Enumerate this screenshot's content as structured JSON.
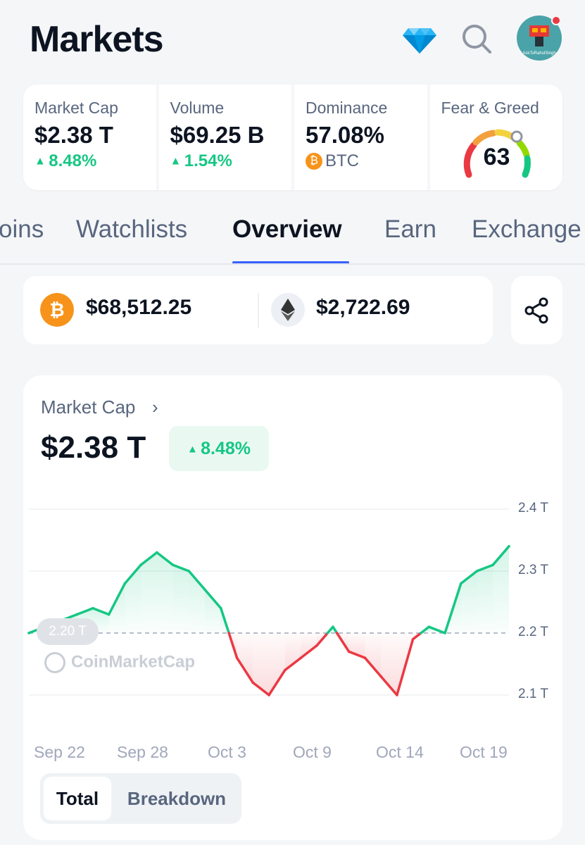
{
  "header": {
    "title": "Markets",
    "icons": [
      "diamond-icon",
      "search-icon",
      "avatar"
    ],
    "avatar_text": "AskToRahulSingh"
  },
  "stats": {
    "market_cap": {
      "label": "Market Cap",
      "value": "$2.38 T",
      "change": "8.48%"
    },
    "volume": {
      "label": "Volume",
      "value": "$69.25 B",
      "change": "1.54%"
    },
    "dominance": {
      "label": "Dominance",
      "value": "57.08%",
      "asset": "BTC"
    },
    "fear_greed": {
      "label": "Fear & Greed",
      "value": "63"
    }
  },
  "tabs": [
    {
      "label": "oins"
    },
    {
      "label": "Watchlists"
    },
    {
      "label": "Overview"
    },
    {
      "label": "Earn"
    },
    {
      "label": "Exchange"
    }
  ],
  "prices": {
    "btc": {
      "value": "$68,512.25"
    },
    "eth": {
      "value": "$2,722.69"
    }
  },
  "chart_card": {
    "title": "Market Cap",
    "value": "$2.38 T",
    "change": "8.48%",
    "reference_label": "2.20 T",
    "watermark": "CoinMarketCap",
    "toggle": {
      "total": "Total",
      "breakdown": "Breakdown"
    }
  },
  "colors": {
    "up": "#16c784",
    "down": "#ea3943",
    "accent": "#3861fb",
    "btc": "#f7931a"
  },
  "chart_data": {
    "type": "line",
    "x_tick_labels": [
      "Sep 22",
      "Sep 28",
      "Oct 3",
      "Oct 9",
      "Oct 14",
      "Oct 19"
    ],
    "y_tick_labels": [
      "2.4 T",
      "2.3 T",
      "2.2 T",
      "2.1 T"
    ],
    "ylim": [
      2.05,
      2.42
    ],
    "baseline": 2.2,
    "x": [
      "Sep 20",
      "Sep 21",
      "Sep 22",
      "Sep 23",
      "Sep 24",
      "Sep 25",
      "Sep 26",
      "Sep 27",
      "Sep 28",
      "Sep 29",
      "Sep 30",
      "Oct 1",
      "Oct 2",
      "Oct 3",
      "Oct 4",
      "Oct 5",
      "Oct 6",
      "Oct 7",
      "Oct 8",
      "Oct 9",
      "Oct 10",
      "Oct 11",
      "Oct 12",
      "Oct 13",
      "Oct 14",
      "Oct 15",
      "Oct 16",
      "Oct 17",
      "Oct 18",
      "Oct 19",
      "Oct 20"
    ],
    "values": [
      2.2,
      2.21,
      2.22,
      2.23,
      2.24,
      2.23,
      2.28,
      2.31,
      2.33,
      2.31,
      2.3,
      2.27,
      2.24,
      2.16,
      2.12,
      2.1,
      2.14,
      2.16,
      2.18,
      2.21,
      2.17,
      2.16,
      2.13,
      2.1,
      2.19,
      2.21,
      2.2,
      2.28,
      2.3,
      2.31,
      2.34
    ],
    "grid": true,
    "legend": "none"
  }
}
